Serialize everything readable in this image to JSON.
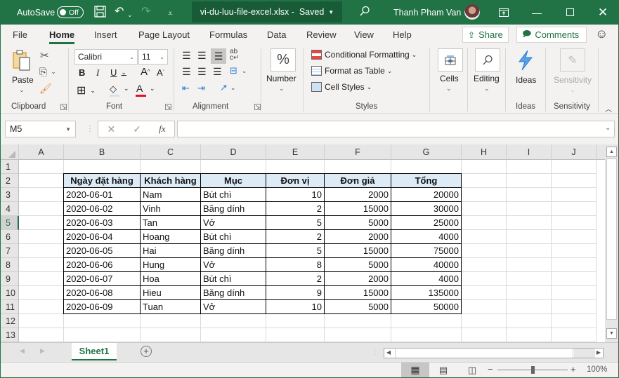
{
  "titlebar": {
    "autosave_label": "AutoSave",
    "autosave_state": "Off",
    "filename": "vi-du-luu-file-excel.xlsx",
    "saved_status": "Saved",
    "user_name": "Thanh Pham Van"
  },
  "menu": {
    "tabs": [
      "File",
      "Home",
      "Insert",
      "Page Layout",
      "Formulas",
      "Data",
      "Review",
      "View",
      "Help"
    ],
    "active_tab": "Home",
    "share_label": "Share",
    "comments_label": "Comments"
  },
  "ribbon": {
    "clipboard": {
      "paste_label": "Paste",
      "group_label": "Clipboard"
    },
    "font": {
      "font_name": "Calibri",
      "font_size": "11",
      "group_label": "Font",
      "font_color": "#e81123",
      "fill_color": "#cfe2f3"
    },
    "alignment": {
      "group_label": "Alignment"
    },
    "number": {
      "label": "Number",
      "icon": "%"
    },
    "styles": {
      "conditional_formatting": "Conditional Formatting",
      "format_as_table": "Format as Table",
      "cell_styles": "Cell Styles",
      "group_label": "Styles"
    },
    "cells": {
      "label": "Cells"
    },
    "editing": {
      "label": "Editing"
    },
    "ideas": {
      "label": "Ideas",
      "group_label": "Ideas"
    },
    "sensitivity": {
      "label": "Sensitivity",
      "group_label": "Sensitivity"
    }
  },
  "formula_bar": {
    "name_box": "M5",
    "fx_label": "fx",
    "formula": ""
  },
  "grid": {
    "columns": [
      "A",
      "B",
      "C",
      "D",
      "E",
      "F",
      "G",
      "H",
      "I",
      "J"
    ],
    "rows": [
      "1",
      "2",
      "3",
      "4",
      "5",
      "6",
      "7",
      "8",
      "9",
      "10",
      "11",
      "12",
      "13"
    ],
    "selected_row": "5",
    "table": {
      "headers": [
        "Ngày đặt hàng",
        "Khách hàng",
        "Mục",
        "Đơn vị",
        "Đơn giá",
        "Tổng"
      ],
      "rows": [
        [
          "2020-06-01",
          "Nam",
          "Bút chì",
          "10",
          "2000",
          "20000"
        ],
        [
          "2020-06-02",
          "Vinh",
          "Băng dính",
          "2",
          "15000",
          "30000"
        ],
        [
          "2020-06-03",
          "Tan",
          "Vở",
          "5",
          "5000",
          "25000"
        ],
        [
          "2020-06-04",
          "Hoang",
          "Bút chì",
          "2",
          "2000",
          "4000"
        ],
        [
          "2020-06-05",
          "Hai",
          "Băng dính",
          "5",
          "15000",
          "75000"
        ],
        [
          "2020-06-06",
          "Hung",
          "Vở",
          "8",
          "5000",
          "40000"
        ],
        [
          "2020-06-07",
          "Hoa",
          "Bút chì",
          "2",
          "2000",
          "4000"
        ],
        [
          "2020-06-08",
          "Hieu",
          "Băng dính",
          "9",
          "15000",
          "135000"
        ],
        [
          "2020-06-09",
          "Tuan",
          "Vở",
          "10",
          "5000",
          "50000"
        ]
      ]
    }
  },
  "sheets": {
    "tabs": [
      "Sheet1"
    ],
    "active": "Sheet1"
  },
  "status": {
    "zoom": "100%",
    "zoom_fraction": 0.5
  },
  "colors": {
    "brand": "#217346",
    "header_fill": "#ddebf7"
  }
}
